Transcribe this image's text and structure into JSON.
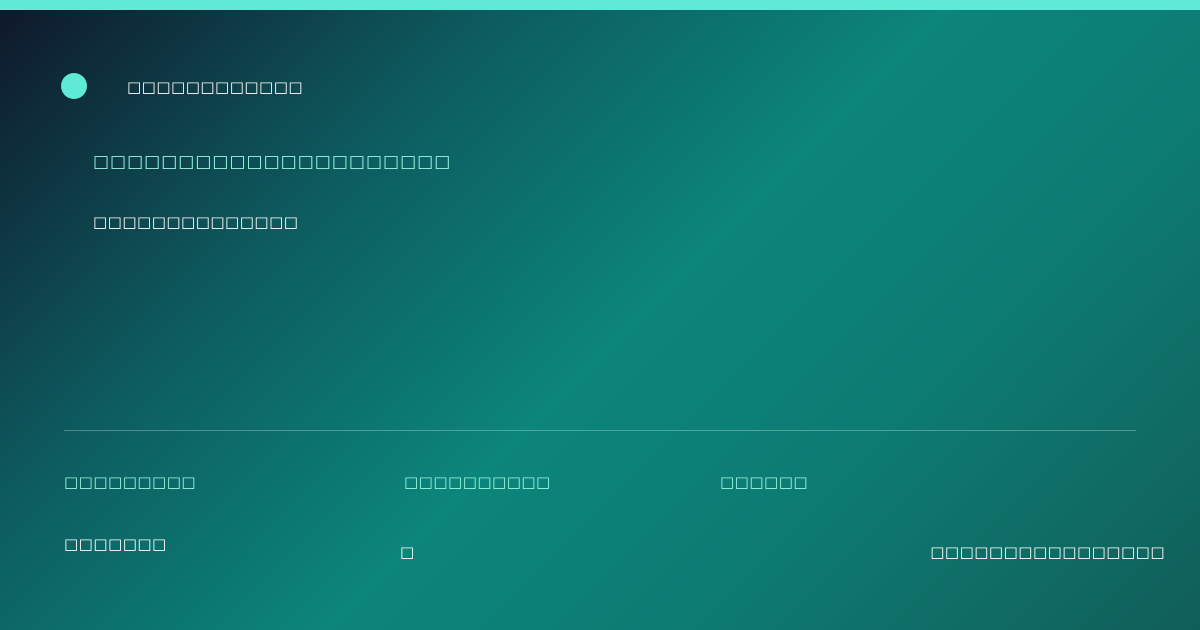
{
  "colors": {
    "accent": "#5eead4",
    "accent_text": "#99f6e4",
    "text": "#ffffff",
    "gradient_start": "#0f172a",
    "gradient_mid": "#0c857b",
    "gradient_end": "#115e59"
  },
  "header": {
    "brand": "□□□□□□□□□□□□"
  },
  "hero": {
    "headline": "□□□□□□□□□□□□□□□□□□□□□",
    "subline": "□□□□□□□□□□□□□□"
  },
  "meta": {
    "item_1": "□□□□□□□□□",
    "item_2": "□□□□□□□□□□",
    "item_3": "□□□□□□"
  },
  "footer": {
    "left": "□□□□□□□",
    "middle": "□",
    "right": "□□□□□□□□□□□□□□□□"
  }
}
